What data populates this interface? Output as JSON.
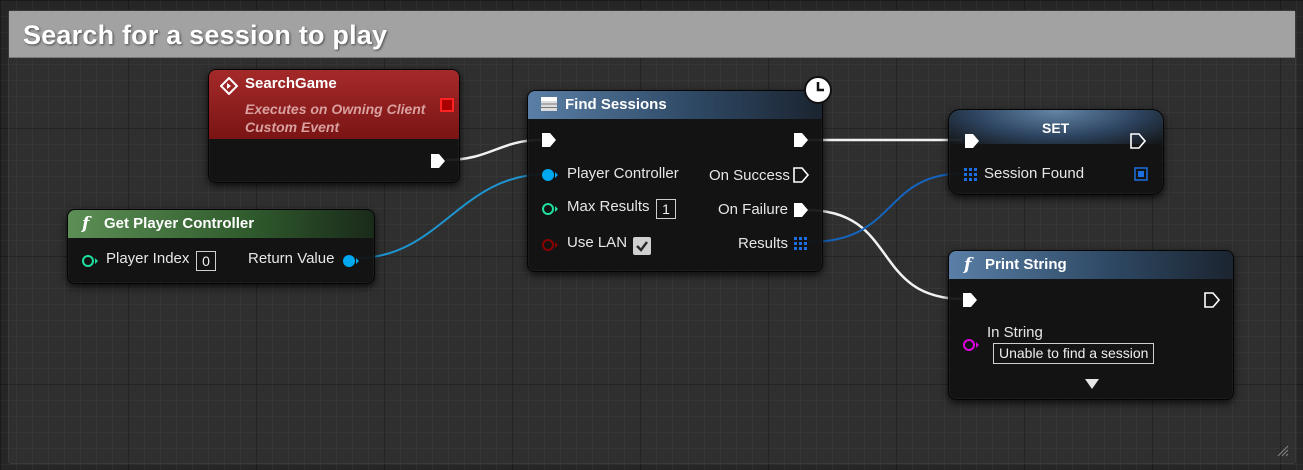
{
  "comment": {
    "title": "Search for a session to play"
  },
  "nodes": {
    "search_game": {
      "title": "SearchGame",
      "subtitle_line1": "Executes on Owning Client",
      "subtitle_line2": "Custom Event",
      "icon": "event-icon",
      "color": "#8a1a1a"
    },
    "get_player_controller": {
      "title": "Get Player Controller",
      "icon": "function-icon",
      "color": "#4a7a44",
      "inputs": {
        "player_index_label": "Player Index",
        "player_index_value": "0"
      },
      "outputs": {
        "return_value_label": "Return Value"
      }
    },
    "find_sessions": {
      "title": "Find Sessions",
      "icon": "latent-action-icon",
      "color": "#3b5a78",
      "inputs": {
        "player_controller_label": "Player Controller",
        "max_results_label": "Max Results",
        "max_results_value": "1",
        "use_lan_label": "Use LAN",
        "use_lan_checked": true
      },
      "outputs": {
        "on_success_label": "On Success",
        "on_failure_label": "On Failure",
        "results_label": "Results"
      }
    },
    "set_node": {
      "title": "SET",
      "variable_label": "Session Found",
      "color": "#4c6a8c"
    },
    "print_string": {
      "title": "Print String",
      "icon": "function-icon",
      "color": "#3b5a78",
      "in_string_label": "In String",
      "in_string_value": "Unable to find a session",
      "expand_icon": "triangle-down-icon"
    }
  },
  "colors": {
    "exec_wire": "#ffffff",
    "object_pin": "#00a8f0",
    "int_pin": "#1fe0a0",
    "bool_pin": "#8b0000",
    "struct_array_pin": "#0a58ca",
    "string_pin": "#e000e0"
  }
}
